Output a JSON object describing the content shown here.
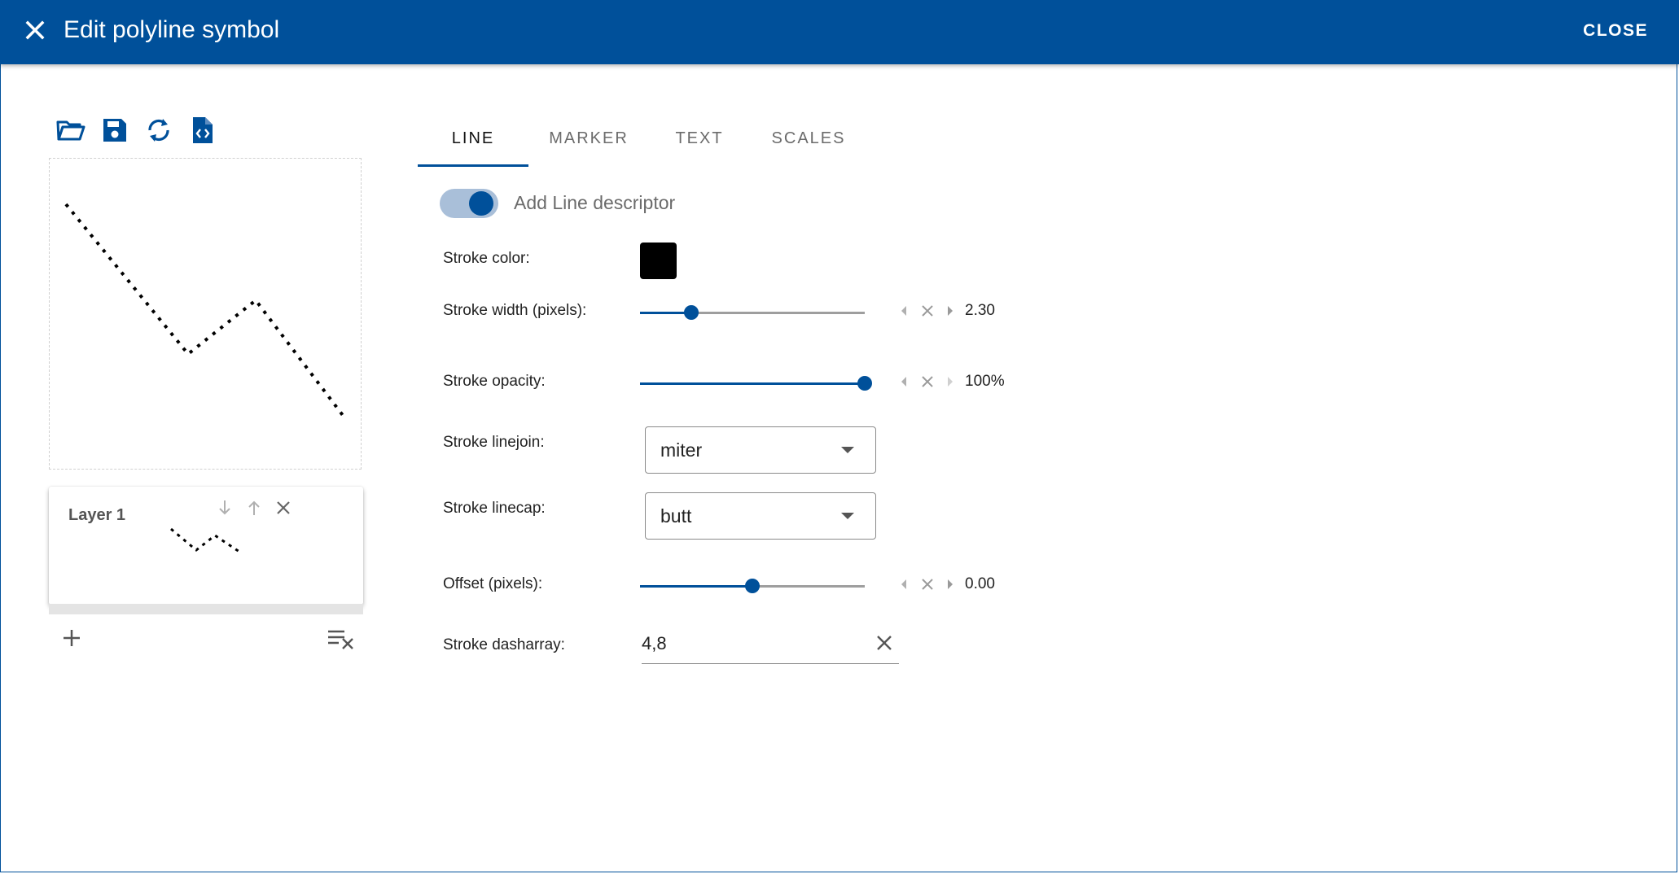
{
  "header": {
    "title": "Edit polyline symbol",
    "close_label": "CLOSE"
  },
  "toolbar": {
    "icons": [
      "folder-open-icon",
      "save-icon",
      "sync-icon",
      "code-file-icon"
    ]
  },
  "layers": [
    {
      "name": "Layer 1"
    }
  ],
  "tabs": [
    {
      "label": "LINE",
      "active": true
    },
    {
      "label": "MARKER",
      "active": false
    },
    {
      "label": "TEXT",
      "active": false
    },
    {
      "label": "SCALES",
      "active": false
    }
  ],
  "line": {
    "toggle_label": "Add Line descriptor",
    "toggle_on": true,
    "stroke_color_label": "Stroke color:",
    "stroke_color": "#000000",
    "stroke_width_label": "Stroke width (pixels):",
    "stroke_width_value": "2.30",
    "stroke_width_fraction": 0.23,
    "stroke_opacity_label": "Stroke opacity:",
    "stroke_opacity_value": "100%",
    "stroke_opacity_fraction": 1.0,
    "linejoin_label": "Stroke linejoin:",
    "linejoin_value": "miter",
    "linecap_label": "Stroke linecap:",
    "linecap_value": "butt",
    "offset_label": "Offset (pixels):",
    "offset_value": "0.00",
    "offset_fraction": 0.5,
    "dasharray_label": "Stroke dasharray:",
    "dasharray_value": "4,8"
  },
  "colors": {
    "brand": "#00509a",
    "toggle_track": "#a9bfd9"
  }
}
